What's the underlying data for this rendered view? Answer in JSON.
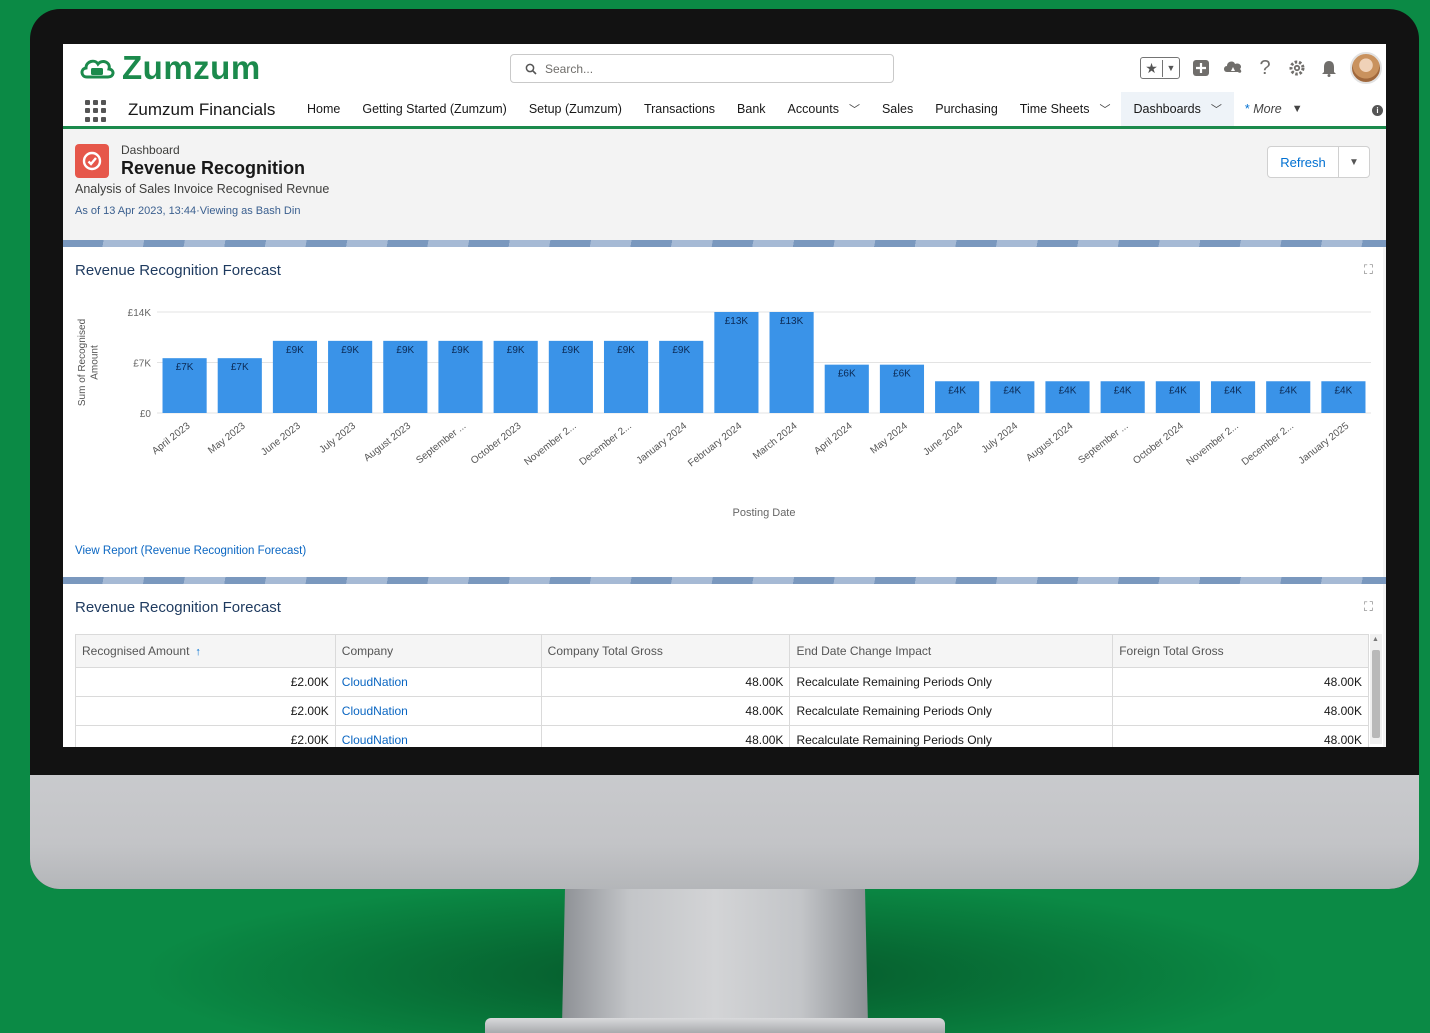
{
  "app": {
    "logo_text": "Zumzum",
    "app_name": "Zumzum Financials",
    "search_placeholder": "Search..."
  },
  "nav": {
    "items": [
      {
        "label": "Home",
        "dropdown": false
      },
      {
        "label": "Getting Started (Zumzum)",
        "dropdown": false
      },
      {
        "label": "Setup (Zumzum)",
        "dropdown": false
      },
      {
        "label": "Transactions",
        "dropdown": false
      },
      {
        "label": "Bank",
        "dropdown": false
      },
      {
        "label": "Accounts",
        "dropdown": true
      },
      {
        "label": "Sales",
        "dropdown": false
      },
      {
        "label": "Purchasing",
        "dropdown": false
      },
      {
        "label": "Time Sheets",
        "dropdown": true
      },
      {
        "label": "Dashboards",
        "dropdown": true,
        "active": true
      }
    ],
    "more_label": "More"
  },
  "dashboard": {
    "type_label": "Dashboard",
    "title": "Revenue Recognition",
    "description": "Analysis of Sales Invoice Recognised Revnue",
    "meta": "As of 13 Apr 2023, 13:44·Viewing as Bash Din",
    "refresh_label": "Refresh"
  },
  "chart_widget": {
    "title": "Revenue Recognition Forecast",
    "view_report": "View Report (Revenue Recognition Forecast)"
  },
  "chart_data": {
    "type": "bar",
    "xlabel": "Posting Date",
    "ylabel": "Sum of Recognised Amount",
    "ylim": [
      0,
      14000
    ],
    "yticks": [
      {
        "value": 0,
        "label": "£0"
      },
      {
        "value": 7000,
        "label": "£7K"
      },
      {
        "value": 14000,
        "label": "£14K"
      }
    ],
    "bar_color": "#3a93e8",
    "categories": [
      "April 2023",
      "May 2023",
      "June 2023",
      "July 2023",
      "August 2023",
      "September ...",
      "October 2023",
      "November 2...",
      "December 2...",
      "January 2024",
      "February 2024",
      "March 2024",
      "April 2024",
      "May 2024",
      "June 2024",
      "July 2024",
      "August 2024",
      "September ...",
      "October 2024",
      "November 2...",
      "December 2...",
      "January 2025"
    ],
    "values": [
      7600,
      7600,
      10000,
      10000,
      10000,
      10000,
      10000,
      10000,
      10000,
      10000,
      14000,
      14000,
      6700,
      6700,
      4400,
      4400,
      4400,
      4400,
      4400,
      4400,
      4400,
      4400
    ],
    "value_labels": [
      "£7K",
      "£7K",
      "£9K",
      "£9K",
      "£9K",
      "£9K",
      "£9K",
      "£9K",
      "£9K",
      "£9K",
      "£13K",
      "£13K",
      "£6K",
      "£6K",
      "£4K",
      "£4K",
      "£4K",
      "£4K",
      "£4K",
      "£4K",
      "£4K",
      "£4K"
    ],
    "grid": true,
    "legend": "none"
  },
  "table_widget": {
    "title": "Revenue Recognition Forecast",
    "columns": [
      "Recognised Amount",
      "Company",
      "Company Total Gross",
      "End Date Change Impact",
      "Foreign Total Gross"
    ],
    "rows": [
      [
        "£2.00K",
        "CloudNation",
        "48.00K",
        "Recalculate Remaining Periods Only",
        "48.00K"
      ],
      [
        "£2.00K",
        "CloudNation",
        "48.00K",
        "Recalculate Remaining Periods Only",
        "48.00K"
      ],
      [
        "£2.00K",
        "CloudNation",
        "48.00K",
        "Recalculate Remaining Periods Only",
        "48.00K"
      ]
    ]
  },
  "colors": {
    "background": "#0b8a45",
    "brand_green": "#1b8a4c",
    "bar": "#3a93e8",
    "link": "#0a66c2"
  }
}
